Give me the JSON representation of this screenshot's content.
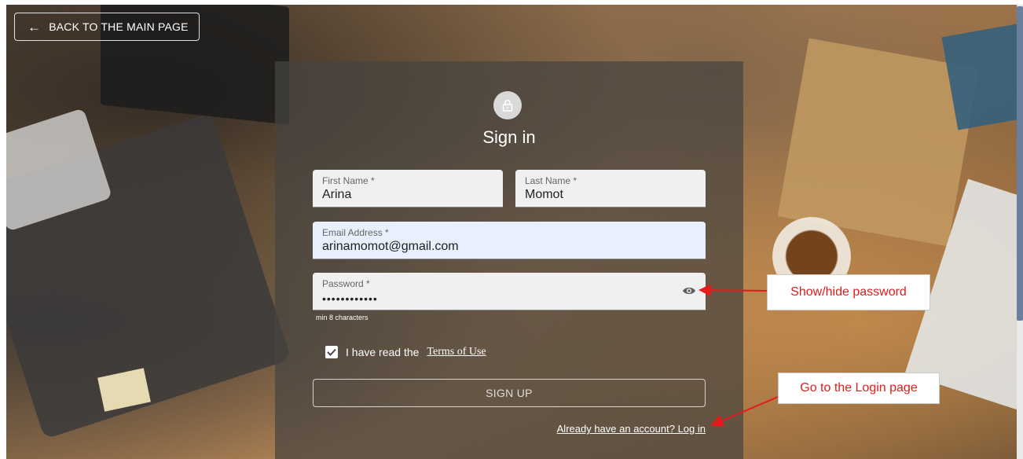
{
  "nav": {
    "back_label": "BACK TO THE MAIN PAGE",
    "back_icon": "arrow-left-icon"
  },
  "form": {
    "lock_icon": "lock-icon",
    "title": "Sign in",
    "first_name": {
      "label": "First Name *",
      "value": "Arina"
    },
    "last_name": {
      "label": "Last Name *",
      "value": "Momot"
    },
    "email": {
      "label": "Email Address *",
      "value": "arinamomot@gmail.com"
    },
    "password": {
      "label": "Password *",
      "value": "••••••••••••",
      "toggle_icon": "eye-icon"
    },
    "password_helper": "min 8 characters",
    "terms": {
      "checked": true,
      "prefix": "I have read the",
      "link": "Terms of Use"
    },
    "signup_label": "SIGN UP",
    "login_link": "Already have an account? Log in"
  },
  "annotations": {
    "show_hide": "Show/hide password",
    "login_page": "Go to the Login page",
    "color": "#e31b1b"
  }
}
